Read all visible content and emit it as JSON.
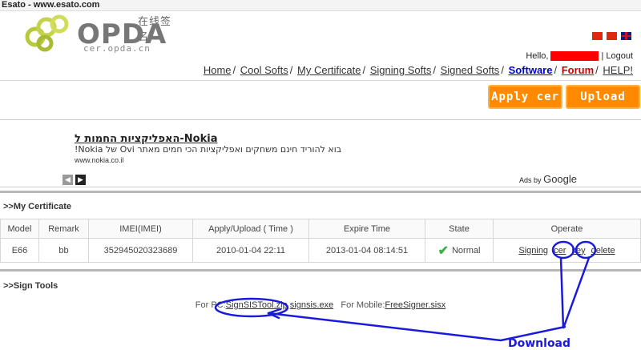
{
  "window": {
    "title": "Esato - www.esato.com"
  },
  "logo": {
    "chinese": "在线签名",
    "word": "OPDA",
    "url": "cer.opda.cn"
  },
  "user": {
    "hello": "Hello,",
    "logout": "| Logout"
  },
  "nav": {
    "items": [
      {
        "label": "Home"
      },
      {
        "label": "Cool Softs"
      },
      {
        "label": "My Certificate"
      },
      {
        "label": "Signing Softs"
      },
      {
        "label": "Signed Softs"
      },
      {
        "label": "Software"
      },
      {
        "label": "Forum"
      },
      {
        "label": "HELP!"
      }
    ],
    "separator": "/"
  },
  "buttons": {
    "apply": "Apply cer",
    "upload": "Upload cer"
  },
  "ad": {
    "title": "Nokia-האפליקציות החמות ל",
    "text": "בוא להוריד חינם משחקים ואפליקציות הכי חמים מאתר Ovi של Nokia!",
    "url": "www.nokia.co.il",
    "prev": "◀",
    "next": "▶",
    "ads_by": "Ads by",
    "google": "Google"
  },
  "my_cert": {
    "title": ">>My Certificate",
    "columns": [
      "Model",
      "Remark",
      "IMEI(IMEI)",
      "Apply/Upload ( Time )",
      "Expire Time",
      "State",
      "Operate"
    ],
    "rows": [
      {
        "model": "E66",
        "remark": "bb",
        "imei": "352945020323689",
        "apply_time": "2010-01-04 22:11",
        "expire_time": "2013-01-04 08:14:51",
        "state": "Normal",
        "ops": {
          "signing": "Signing",
          "cer": "cer",
          "key": "key",
          "delete": "delete"
        }
      }
    ]
  },
  "sign_tools": {
    "title": ">>Sign Tools",
    "pc_label": "For PC:",
    "pc_file1": "SignSISTool.zip",
    "pc_file2": "signsis.exe",
    "mobile_label": "For Mobile:",
    "mobile_file": "FreeSigner.sisx"
  },
  "annotation": {
    "label": "Download",
    "color": "#1a1adc"
  }
}
